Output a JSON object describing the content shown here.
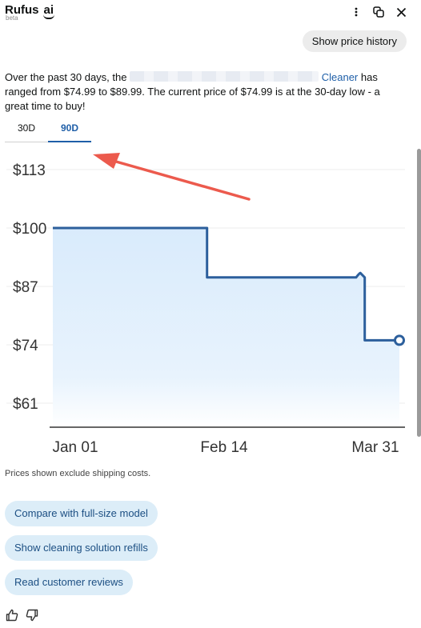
{
  "header": {
    "title": "Rufus",
    "ai_badge": "ai",
    "subtitle": "beta",
    "icons": [
      "more-vertical-icon",
      "popout-icon",
      "close-icon"
    ]
  },
  "price_history_chip": "Show price history",
  "message": {
    "intro": "Over the past 30 days, the",
    "product_link": "Cleaner",
    "body": "has ranged from $74.99 to $89.99. The current price of $74.99 is at the 30-day low - a great time to buy!"
  },
  "tabs": [
    {
      "label": "30D",
      "active": false
    },
    {
      "label": "90D",
      "active": true
    }
  ],
  "chart_data": {
    "type": "line",
    "y_ticks": [
      "$113",
      "$100",
      "$87",
      "$74",
      "$61"
    ],
    "x_ticks": [
      "Jan 01",
      "Feb 14",
      "Mar 31"
    ],
    "ylim": [
      61,
      113
    ],
    "x": [
      0,
      44.5,
      44.5,
      87.5,
      88.5,
      90,
      90,
      100
    ],
    "y": [
      100,
      100,
      89,
      89,
      90,
      89,
      75,
      75
    ],
    "line_color": "#2c5f9c",
    "fill_color": "#dcecfb"
  },
  "annotation": {
    "color": "#ec5a4d"
  },
  "shipping_note": "Prices shown exclude shipping costs.",
  "suggestions": [
    "Compare with full-size model",
    "Show cleaning solution refills",
    "Read customer reviews"
  ],
  "feedback": [
    "thumbs-up-icon",
    "thumbs-down-icon"
  ]
}
